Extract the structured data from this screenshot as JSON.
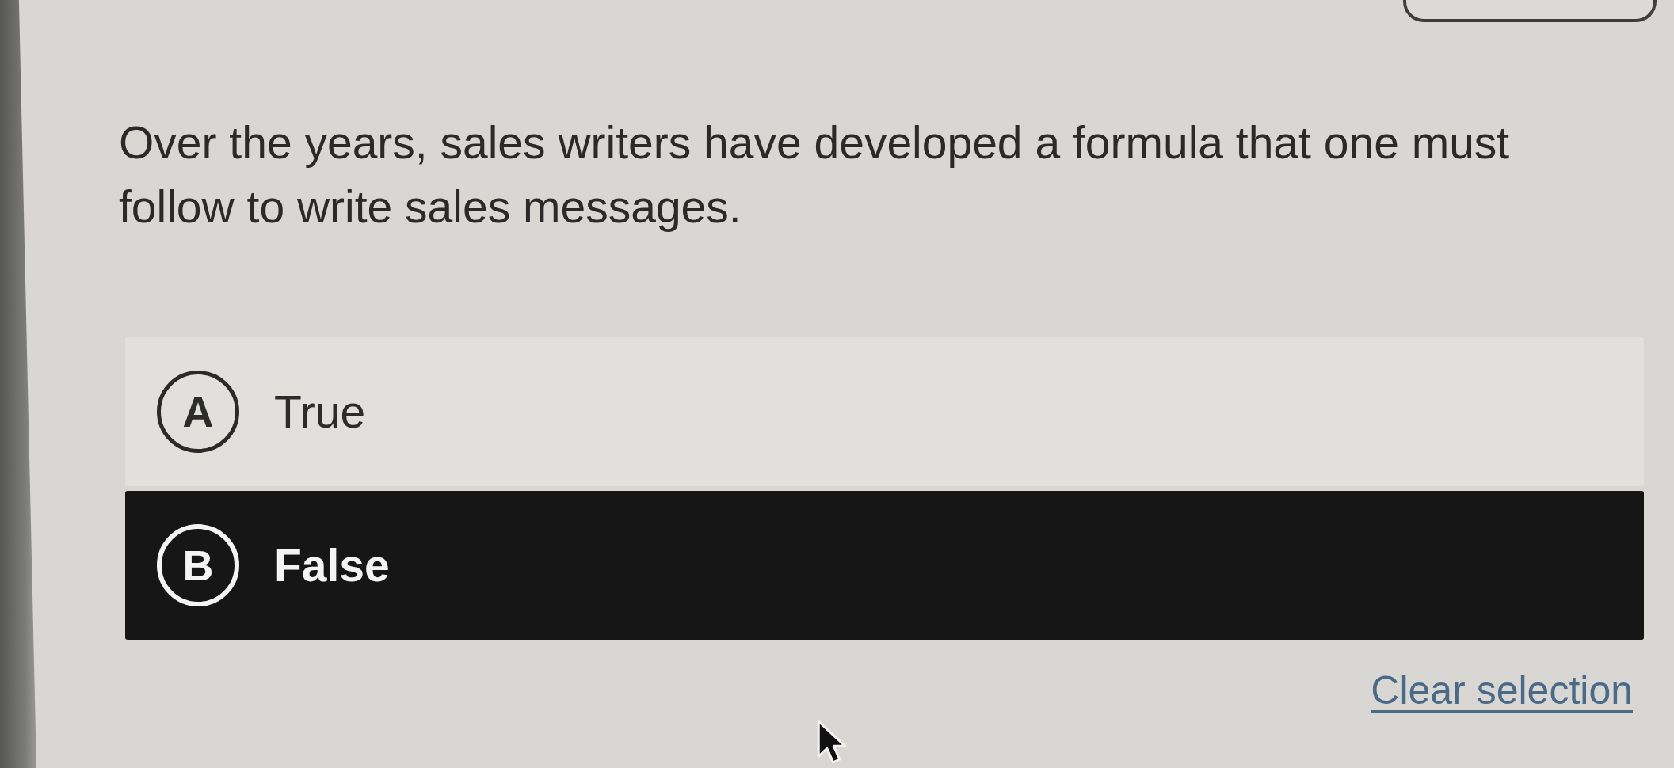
{
  "question": {
    "text": "Over the years, sales writers have developed a formula that one must follow to write sales messages."
  },
  "options": [
    {
      "letter": "A",
      "label": "True",
      "selected": false
    },
    {
      "letter": "B",
      "label": "False",
      "selected": true
    }
  ],
  "clear_link": {
    "label": "Clear selection"
  }
}
